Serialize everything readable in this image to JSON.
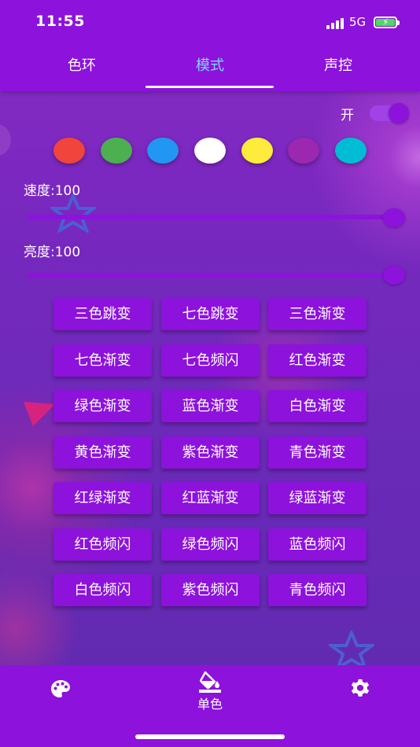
{
  "status": {
    "time": "11:55",
    "network": "5G"
  },
  "tabs": [
    {
      "label": "色环",
      "active": false
    },
    {
      "label": "模式",
      "active": true
    },
    {
      "label": "声控",
      "active": false
    }
  ],
  "power": {
    "label": "开",
    "on": true
  },
  "colors": [
    {
      "name": "red",
      "hex": "#f0443c"
    },
    {
      "name": "green",
      "hex": "#4caf50"
    },
    {
      "name": "blue",
      "hex": "#2196f3"
    },
    {
      "name": "white",
      "hex": "#ffffff"
    },
    {
      "name": "yellow",
      "hex": "#ffeb3b"
    },
    {
      "name": "purple",
      "hex": "#9c27b0"
    },
    {
      "name": "cyan",
      "hex": "#00bcd4"
    }
  ],
  "speed": {
    "label": "速度:100",
    "value": 100,
    "max": 100
  },
  "brightness": {
    "label": "亮度:100",
    "value": 100,
    "max": 100
  },
  "modes": [
    [
      "三色跳变",
      "七色跳变",
      "三色渐变"
    ],
    [
      "七色渐变",
      "七色频闪",
      "红色渐变"
    ],
    [
      "绿色渐变",
      "蓝色渐变",
      "白色渐变"
    ],
    [
      "黄色渐变",
      "紫色渐变",
      "青色渐变"
    ],
    [
      "红绿渐变",
      "红蓝渐变",
      "绿蓝渐变"
    ],
    [
      "红色频闪",
      "绿色频闪",
      "蓝色频闪"
    ],
    [
      "白色频闪",
      "紫色频闪",
      "青色频闪"
    ]
  ],
  "bottom_nav": {
    "left_icon": "palette-icon",
    "center_icon": "paint-bucket-icon",
    "center_label": "单色",
    "right_icon": "gear-icon"
  },
  "theme": {
    "primary": "#8d12dc",
    "active_tab": "#7fd8ff"
  }
}
